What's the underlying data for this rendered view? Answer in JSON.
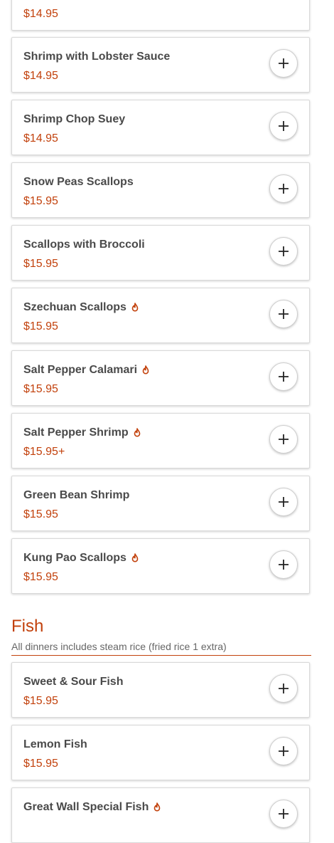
{
  "colors": {
    "accent": "#c2410c",
    "text": "#4a4a4a",
    "spicy": "#c2410c"
  },
  "top_items": [
    {
      "name": "",
      "price": "$14.95",
      "spicy": false
    },
    {
      "name": "Shrimp with Lobster Sauce",
      "price": "$14.95",
      "spicy": false
    },
    {
      "name": "Shrimp Chop Suey",
      "price": "$14.95",
      "spicy": false
    },
    {
      "name": "Snow Peas Scallops",
      "price": "$15.95",
      "spicy": false
    },
    {
      "name": "Scallops with Broccoli",
      "price": "$15.95",
      "spicy": false
    },
    {
      "name": "Szechuan Scallops",
      "price": "$15.95",
      "spicy": true
    },
    {
      "name": "Salt Pepper Calamari",
      "price": "$15.95",
      "spicy": true
    },
    {
      "name": "Salt Pepper Shrimp",
      "price": "$15.95+",
      "spicy": true
    },
    {
      "name": "Green Bean Shrimp",
      "price": "$15.95",
      "spicy": false
    },
    {
      "name": "Kung Pao Scallops",
      "price": "$15.95",
      "spicy": true
    }
  ],
  "fish_section": {
    "title": "Fish",
    "subtitle": "All dinners includes steam rice (fried rice 1 extra)",
    "items": [
      {
        "name": "Sweet & Sour Fish",
        "price": "$15.95",
        "spicy": false
      },
      {
        "name": "Lemon Fish",
        "price": "$15.95",
        "spicy": false
      },
      {
        "name": "Great Wall Special Fish",
        "price": "",
        "spicy": true
      }
    ]
  },
  "icons": {
    "add": "plus-icon",
    "spicy": "flame-icon"
  }
}
